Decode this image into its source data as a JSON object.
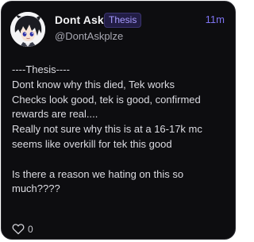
{
  "post": {
    "author_name": "Dont Ask",
    "tag": "Thesis",
    "time_ago": "11m",
    "handle": "@DontAskplze",
    "avatar_icon": "anime-avatar",
    "body_lines": [
      "----Thesis----",
      "Dont know why this died, Tek works",
      "Checks look good, tek is good, confirmed",
      "rewards are real....",
      "Really not sure why this is at a 16-17k mc",
      "seems like overkill for tek this good",
      "",
      "Is there a reason we hating on this so",
      "much????"
    ],
    "like_icon": "heart-icon",
    "like_count": "0"
  },
  "colors": {
    "card_bg": "#0d0d10",
    "accent": "#7d73f0",
    "badge_text": "#a79bff",
    "badge_bg": "#221d45"
  }
}
